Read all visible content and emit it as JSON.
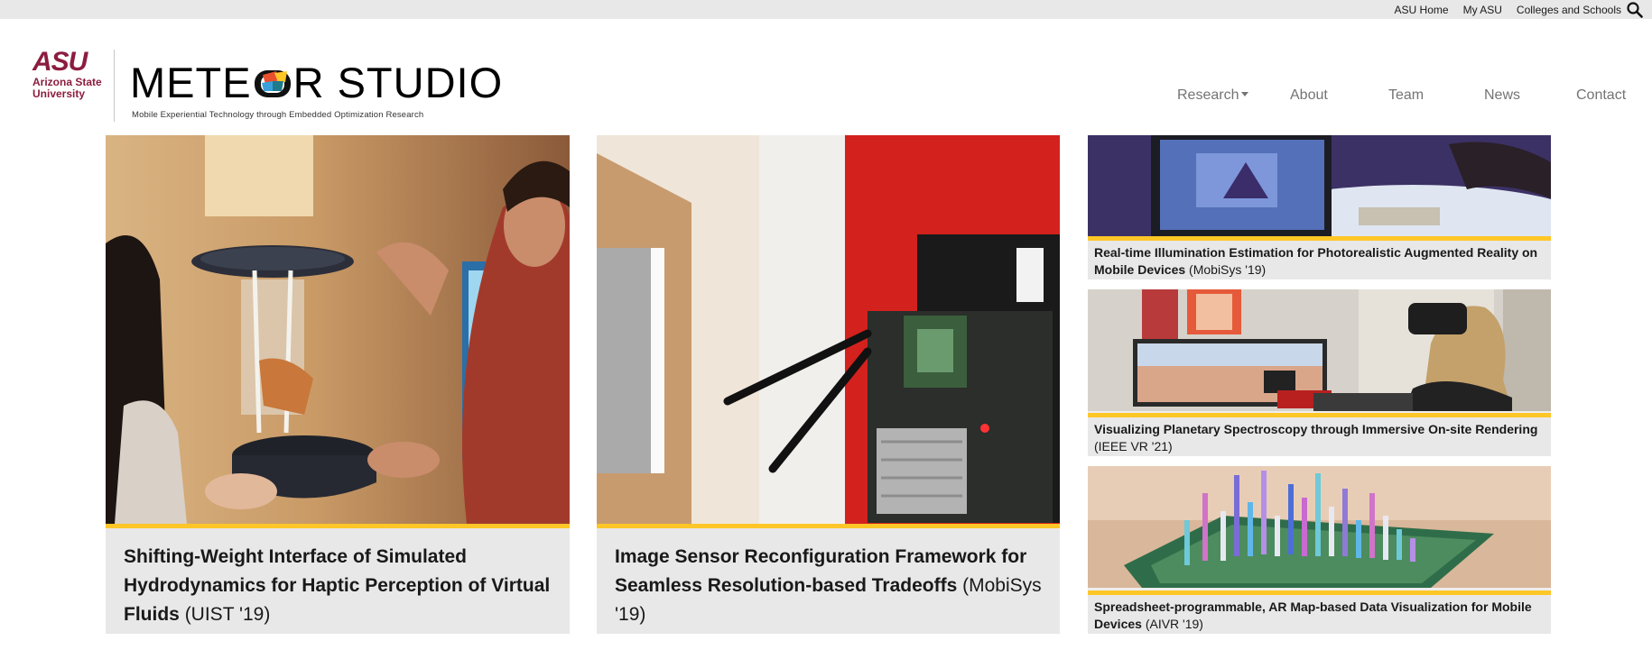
{
  "topbar": {
    "links": [
      "ASU Home",
      "My ASU",
      "Colleges and Schools"
    ],
    "search_icon": "search-icon"
  },
  "header": {
    "asu_logo_mark": "ASU",
    "asu_logo_name_line1": "Arizona State",
    "asu_logo_name_line2": "University",
    "site_title_part1": "METE",
    "site_title_part2": "R STUDIO",
    "site_subtitle": "Mobile Experiential Technology through Embedded Optimization Research"
  },
  "nav": {
    "items": [
      {
        "label": "Research",
        "has_dropdown": true
      },
      {
        "label": "About"
      },
      {
        "label": "Team"
      },
      {
        "label": "News"
      },
      {
        "label": "Contact"
      }
    ]
  },
  "colors": {
    "asu_maroon": "#8c1d40",
    "asu_gold": "#ffc627",
    "nav_text": "#747474",
    "caption_bg": "#e8e8e8"
  },
  "cards": [
    {
      "title": "Shifting-Weight Interface of Simulated Hydrodynamics for Haptic Perception of Virtual Fluids",
      "venue": "(UIST '19)"
    },
    {
      "title": "Image Sensor Reconfiguration Framework for Seamless Resolution-based Tradeoffs",
      "venue": "(MobiSys '19)"
    },
    {
      "title": "Real-time Illumination Estimation for Photorealistic Augmented Reality on Mobile Devices",
      "venue": "(MobiSys '19)"
    },
    {
      "title": "Visualizing Planetary Spectroscopy through Immersive On-site Rendering",
      "venue": "(IEEE VR '21)"
    },
    {
      "title": "Spreadsheet-programmable, AR Map-based Data Visualization for Mobile Devices",
      "venue": "(AIVR '19)"
    }
  ]
}
